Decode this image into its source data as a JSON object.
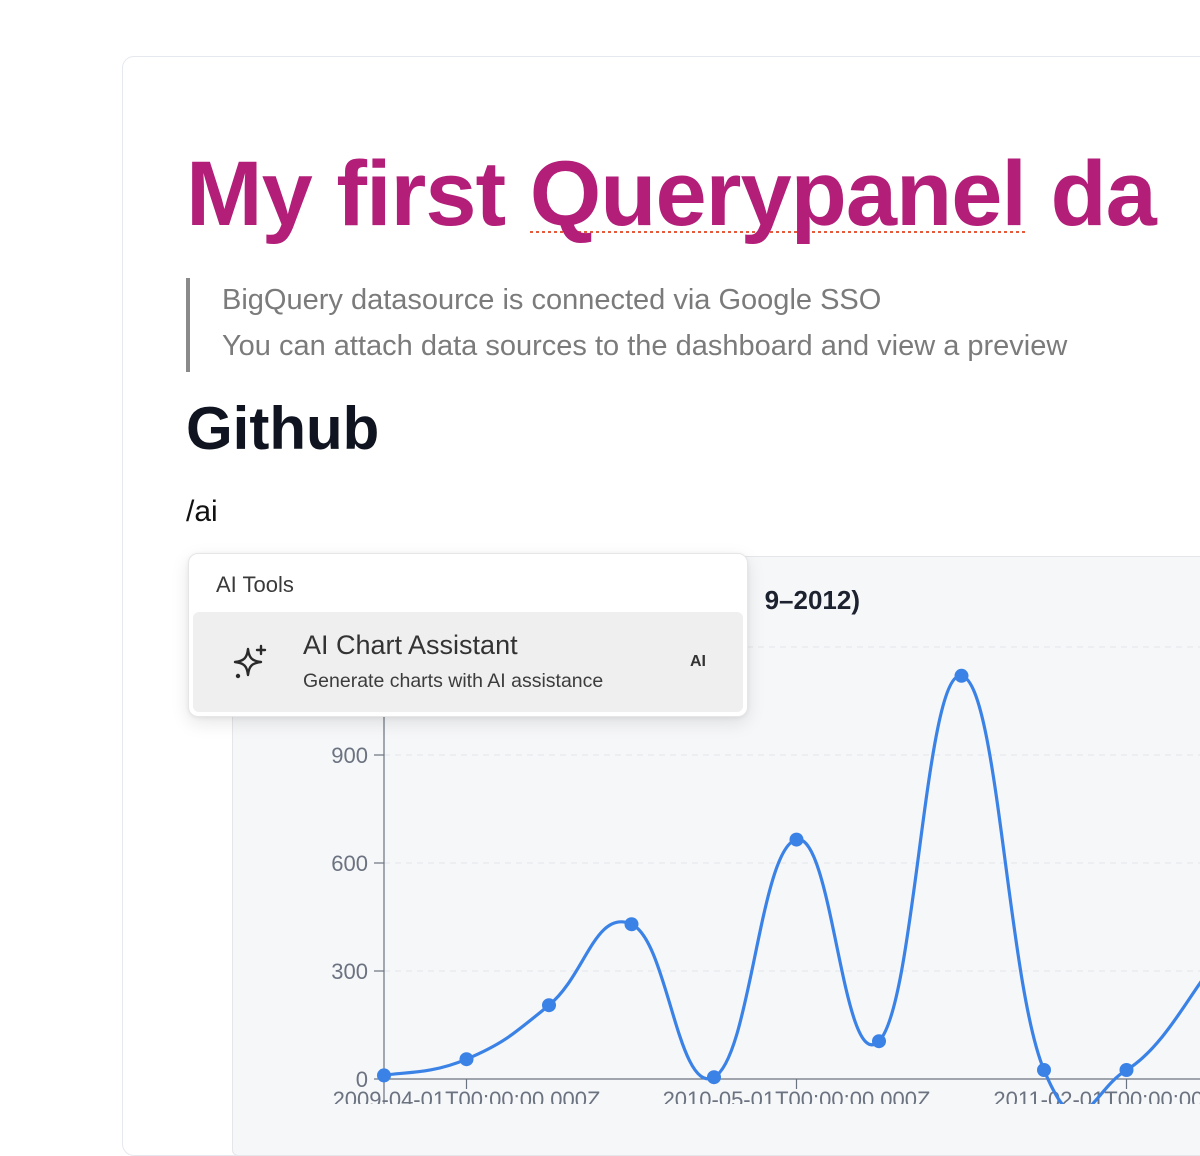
{
  "document": {
    "title_main": "My first ",
    "title_flagged": "Querypanel",
    "title_tail": " da",
    "quote_lines": [
      "BigQuery datasource is connected via Google SSO",
      "You can attach data sources to the dashboard and view a preview"
    ],
    "section_heading": "Github",
    "slash_command": "/ai"
  },
  "ai_menu": {
    "header": "AI Tools",
    "items": [
      {
        "icon": "sparkles-icon",
        "title": "AI Chart Assistant",
        "description": "Generate charts with AI assistance",
        "badge": "AI"
      }
    ]
  },
  "chart_data": {
    "type": "line",
    "title": "9–2012)",
    "series_color": "#3b82e6",
    "x": [
      "2009-04-01T00:00:00.000Z",
      "2009-07-01T00:00:00.000Z",
      "2009-10-01T00:00:00.000Z",
      "2010-01-01T00:00:00.000Z",
      "2010-04-01T00:00:00.000Z",
      "2010-05-01T00:00:00.000Z",
      "2010-08-01T00:00:00.000Z",
      "2010-11-01T00:00:00.000Z",
      "2011-02-01T00:00:00.000Z",
      "2011-05-01T00:00:00.000Z",
      "2011-08-01T00:00:00.000Z"
    ],
    "y": [
      10,
      55,
      205,
      430,
      5,
      665,
      105,
      1120,
      25,
      25,
      300
    ],
    "yticks": [
      0,
      300,
      600,
      900
    ],
    "xtick_labels": [
      "2009-04-01T00:00:00.000Z",
      "2010-05-01T00:00:00.000Z",
      "2011-02-01T00:00:00.000Z"
    ],
    "xtick_positions": [
      1,
      5,
      9
    ],
    "ylim": [
      0,
      1200
    ],
    "grid": true
  }
}
